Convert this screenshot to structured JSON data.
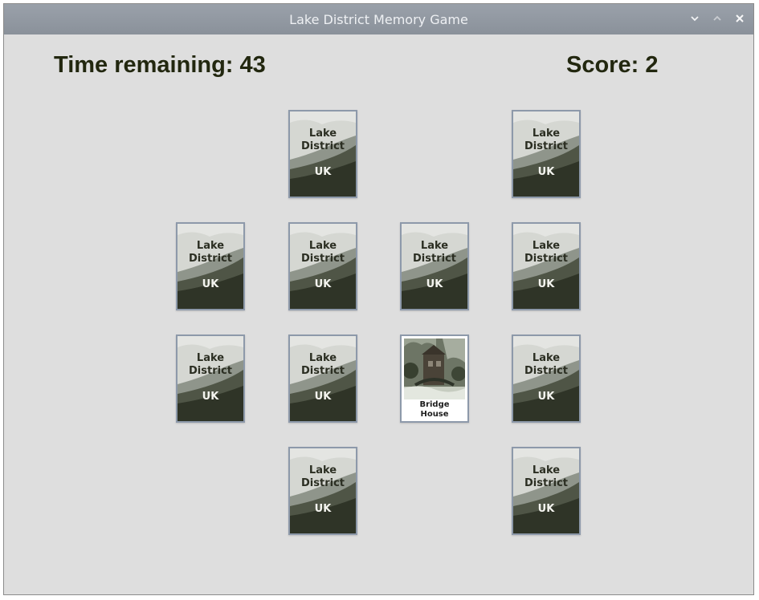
{
  "window": {
    "title": "Lake District Memory Game",
    "controls": [
      {
        "name": "minimize-icon",
        "glyph": "⌄"
      },
      {
        "name": "maximize-icon",
        "glyph": "˄"
      },
      {
        "name": "close-icon",
        "glyph": "✕"
      }
    ]
  },
  "status": {
    "time_label": "Time remaining: 43",
    "score_label": "Score: 2"
  },
  "card_back": {
    "line1": "Lake",
    "line2": "District",
    "line3": "UK"
  },
  "cards": [
    {
      "row": 0,
      "col": 1,
      "state": "face-down"
    },
    {
      "row": 0,
      "col": 3,
      "state": "face-down"
    },
    {
      "row": 1,
      "col": 0,
      "state": "face-down"
    },
    {
      "row": 1,
      "col": 1,
      "state": "face-down"
    },
    {
      "row": 1,
      "col": 2,
      "state": "face-down"
    },
    {
      "row": 1,
      "col": 3,
      "state": "face-down"
    },
    {
      "row": 2,
      "col": 0,
      "state": "face-down"
    },
    {
      "row": 2,
      "col": 1,
      "state": "face-down"
    },
    {
      "row": 2,
      "col": 2,
      "state": "face-up",
      "caption_line1": "Bridge",
      "caption_line2": "House"
    },
    {
      "row": 2,
      "col": 3,
      "state": "face-down"
    },
    {
      "row": 3,
      "col": 1,
      "state": "face-down"
    },
    {
      "row": 3,
      "col": 3,
      "state": "face-down"
    }
  ],
  "colors": {
    "window_bg": "#dedede",
    "titlebar": "#8a919a",
    "status_text": "#22270f",
    "card_border": "#8d99aa"
  }
}
